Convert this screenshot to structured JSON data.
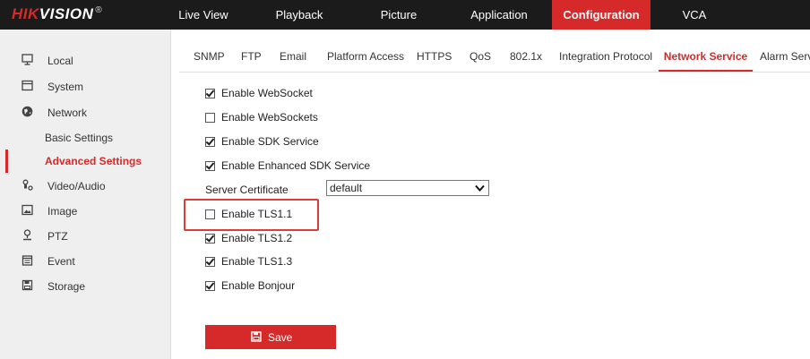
{
  "brand": {
    "logo_red": "HIK",
    "logo_white": "VISION",
    "logo_mark": "®"
  },
  "top_nav": {
    "live_view": "Live View",
    "playback": "Playback",
    "picture": "Picture",
    "application": "Application",
    "configuration": "Configuration",
    "vca": "VCA"
  },
  "sidebar": {
    "local": "Local",
    "system": "System",
    "network": "Network",
    "basic_settings": "Basic Settings",
    "advanced_settings": "Advanced Settings",
    "video_audio": "Video/Audio",
    "image": "Image",
    "ptz": "PTZ",
    "event": "Event",
    "storage": "Storage"
  },
  "tabs": {
    "snmp": "SNMP",
    "ftp": "FTP",
    "email": "Email",
    "platform_access": "Platform Access",
    "https": "HTTPS",
    "qos": "QoS",
    "dot1x": "802.1x",
    "integration_protocol": "Integration Protocol",
    "network_service": "Network Service",
    "alarm_server": "Alarm Serve"
  },
  "form": {
    "websocket": {
      "label": "Enable WebSocket",
      "checked": true
    },
    "websockets": {
      "label": "Enable WebSockets",
      "checked": false
    },
    "sdk_service": {
      "label": "Enable SDK Service",
      "checked": true
    },
    "enhanced_sdk": {
      "label": "Enable Enhanced SDK Service",
      "checked": true
    },
    "server_certificate": {
      "label": "Server Certificate",
      "value": "default"
    },
    "tls11": {
      "label": "Enable TLS1.1",
      "checked": false
    },
    "tls12": {
      "label": "Enable TLS1.2",
      "checked": true
    },
    "tls13": {
      "label": "Enable TLS1.3",
      "checked": true
    },
    "bonjour": {
      "label": "Enable Bonjour",
      "checked": true
    }
  },
  "save_label": "Save",
  "colors": {
    "accent": "#d62a2a",
    "topbar": "#1b1b1b",
    "sidebar": "#efefef",
    "highlight": "#e23a3a"
  },
  "icons": {
    "local": "monitor-icon",
    "system": "window-icon",
    "network": "globe-icon",
    "video_audio": "camera-audio-icon",
    "image": "image-icon",
    "ptz": "ptz-icon",
    "event": "calendar-icon",
    "storage": "floppy-icon",
    "save": "floppy-icon",
    "select": "chevron-down-icon"
  }
}
